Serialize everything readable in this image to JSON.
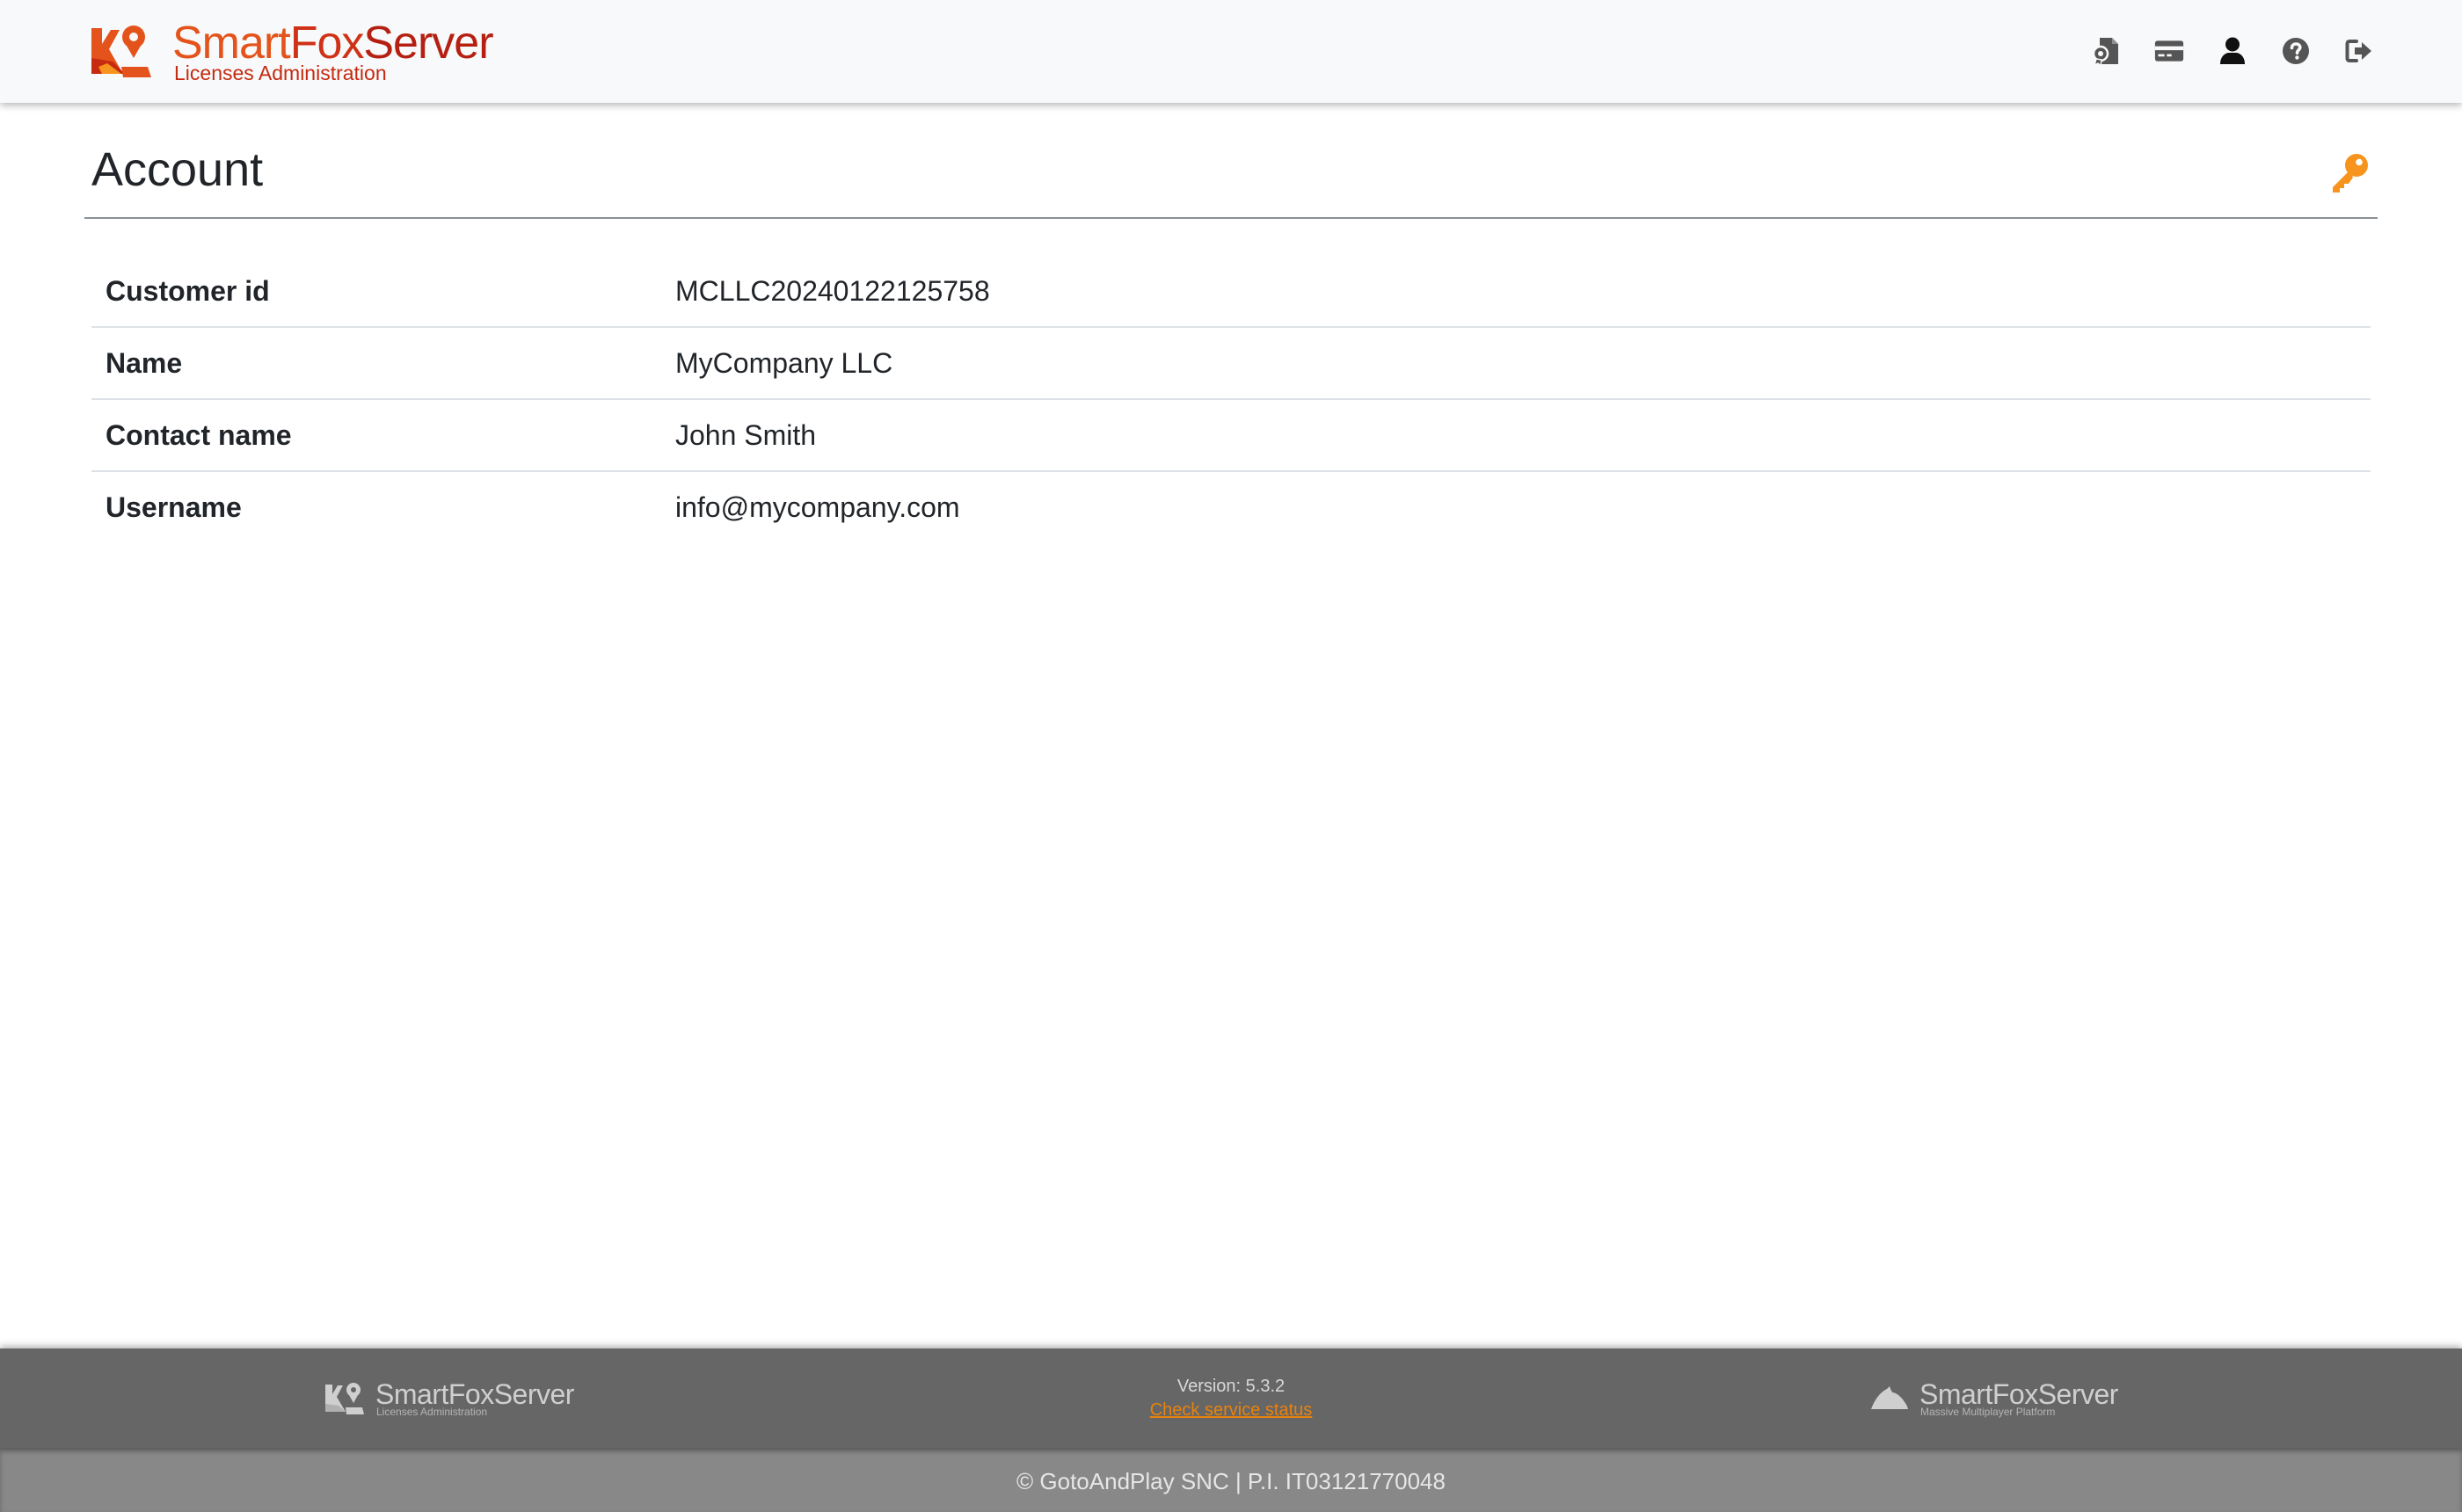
{
  "header": {
    "brand_name_smart": "Smart",
    "brand_name_fox": "Fox",
    "brand_name_server": "Server",
    "brand_subtitle": "Licenses Administration",
    "icons": [
      "license-file-icon",
      "credit-card-icon",
      "user-icon",
      "help-icon",
      "sign-out-icon"
    ]
  },
  "page": {
    "title": "Account",
    "action_icon": "key-icon",
    "accent_color": "#f7941d"
  },
  "account": {
    "rows": [
      {
        "label": "Customer id",
        "value": "MCLLC20240122125758"
      },
      {
        "label": "Name",
        "value": "MyCompany LLC"
      },
      {
        "label": "Contact name",
        "value": "John Smith"
      },
      {
        "label": "Username",
        "value": "info@mycompany.com"
      }
    ]
  },
  "footer": {
    "left_logo_name": "SmartFoxServer",
    "left_logo_sub": "Licenses Administration",
    "version": "Version: 5.3.2",
    "status_link": "Check service status",
    "right_logo_name": "SmartFoxServer",
    "right_logo_sub": "Massive Multiplayer Platform",
    "copyright": "© GotoAndPlay SNC | P.I. IT03121770048",
    "link_color": "#e8820c"
  }
}
